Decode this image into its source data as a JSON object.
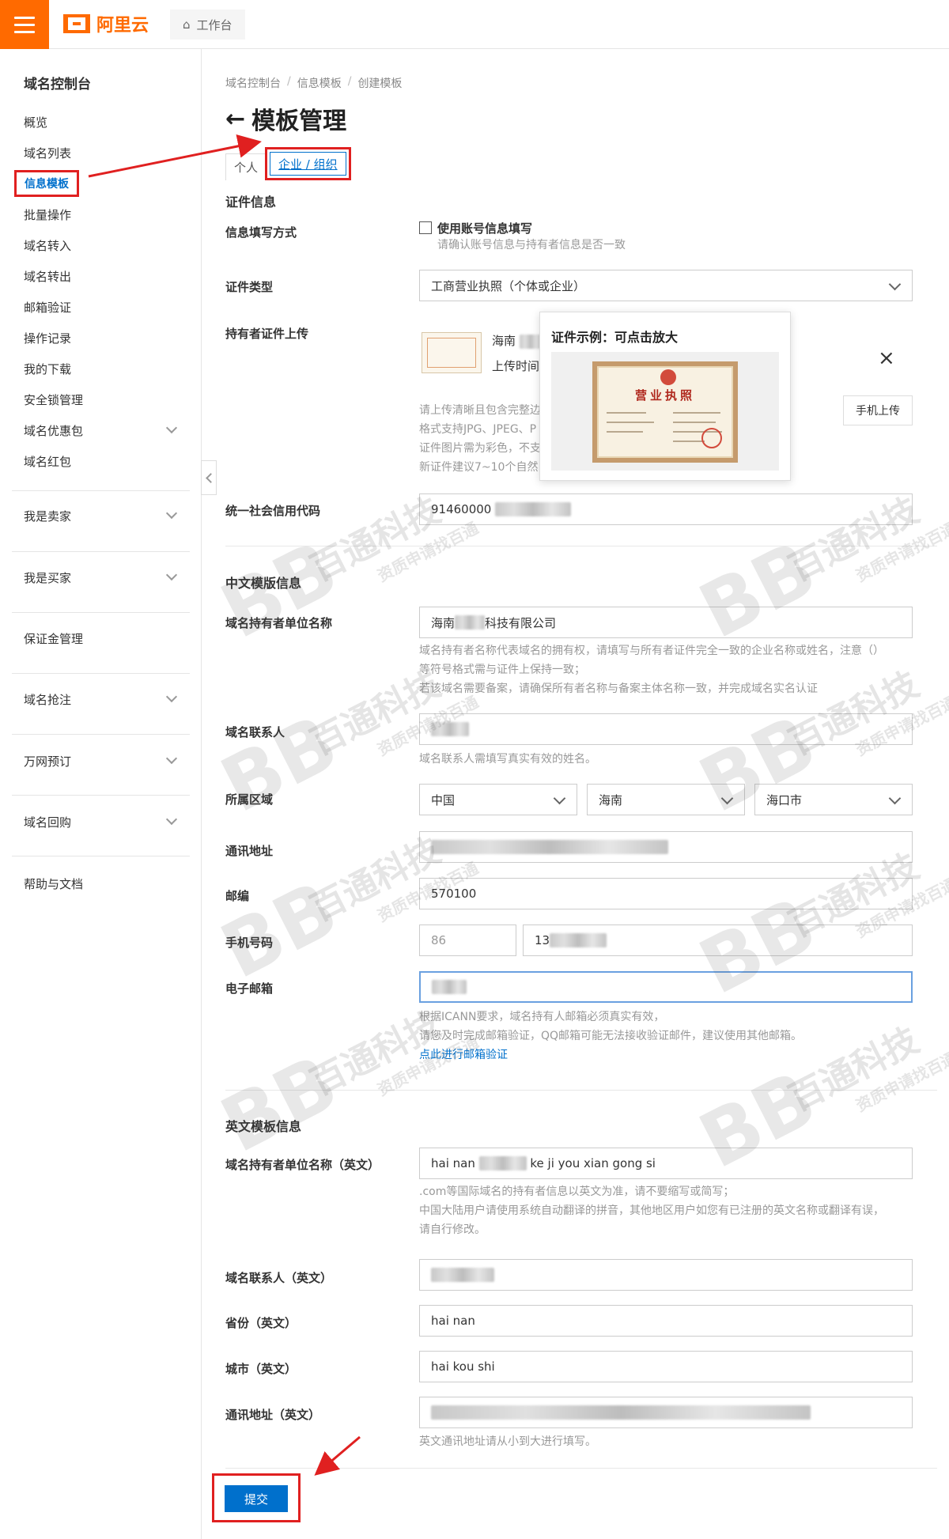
{
  "brand": {
    "name": "阿里云",
    "workbench": "工作台"
  },
  "sidebar": {
    "title": "域名控制台",
    "items": [
      "概览",
      "域名列表",
      "信息模板",
      "批量操作",
      "域名转入",
      "域名转出",
      "邮箱验证",
      "操作记录",
      "我的下载",
      "安全锁管理",
      "域名优惠包",
      "域名红包"
    ],
    "groups": [
      "我是卖家",
      "我是买家",
      "保证金管理",
      "域名抢注",
      "万网预订",
      "域名回购",
      "帮助与文档"
    ]
  },
  "breadcrumb": [
    "域名控制台",
    "信息模板",
    "创建模板"
  ],
  "page": {
    "title": "模板管理"
  },
  "tabs": {
    "personal": "个人",
    "company": "企业 / 组织"
  },
  "cert": {
    "section": "证件信息",
    "fill_mode_label": "信息填写方式",
    "fill_mode_checkbox": "使用账号信息填写",
    "fill_mode_hint": "请确认账号信息与持有者信息是否一致",
    "type_label": "证件类型",
    "type_value": "工商营业执照（个体或企业）",
    "upload_label": "持有者证件上传",
    "upload_name": "海南",
    "upload_time": "上传时间",
    "upload_hints": [
      "请上传清晰且包含完整边",
      "格式支持JPG、JPEG、P",
      "证件图片需为彩色，不支",
      "新证件建议7~10个自然"
    ],
    "mobile_upload": "手机上传",
    "popover_title": "证件示例：可点击放大",
    "sample_title": "营业执照",
    "credit_label": "统一社会信用代码",
    "credit_value": "91460000"
  },
  "cn": {
    "section": "中文模版信息",
    "holder_label": "域名持有者单位名称",
    "holder_prefix": "海南",
    "holder_suffix": "科技有限公司",
    "holder_hints": [
      "域名持有者名称代表域名的拥有权，请填写与所有者证件完全一致的企业名称或姓名，注意（）",
      "等符号格式需与证件上保持一致；",
      "若该域名需要备案，请确保所有者名称与备案主体名称一致，并完成域名实名认证"
    ],
    "contact_label": "域名联系人",
    "contact_hint": "域名联系人需填写真实有效的姓名。",
    "region_label": "所属区域",
    "region": [
      "中国",
      "海南",
      "海口市"
    ],
    "address_label": "通讯地址",
    "zip_label": "邮编",
    "zip_value": "570100",
    "phone_label": "手机号码",
    "phone_code": "86",
    "phone_prefix": "13",
    "email_label": "电子邮箱",
    "email_hints": [
      "根据ICANN要求，域名持有人邮箱必须真实有效，",
      "请您及时完成邮箱验证，QQ邮箱可能无法接收验证邮件，建议使用其他邮箱。"
    ],
    "email_link": "点此进行邮箱验证"
  },
  "en": {
    "section": "英文模板信息",
    "holder_label": "域名持有者单位名称（英文）",
    "holder_prefix": "hai nan",
    "holder_suffix": "ke ji you xian gong si",
    "holder_hints": [
      ".com等国际域名的持有者信息以英文为准，请不要缩写或简写；",
      "中国大陆用户请使用系统自动翻译的拼音，其他地区用户如您有已注册的英文名称或翻译有误，",
      "请自行修改。"
    ],
    "contact_label": "域名联系人（英文）",
    "province_label": "省份（英文）",
    "province_value": "hai nan",
    "city_label": "城市（英文）",
    "city_value": "hai kou shi",
    "address_label": "通讯地址（英文）",
    "address_hint": "英文通讯地址请从小到大进行填写。"
  },
  "submit": "提交",
  "watermark": {
    "main": "百通科技",
    "sub": "资质申请找百通",
    "logo": "BB"
  },
  "colors": {
    "accent": "#ff6a00",
    "link": "#0070cc",
    "highlight": "#e02020"
  }
}
